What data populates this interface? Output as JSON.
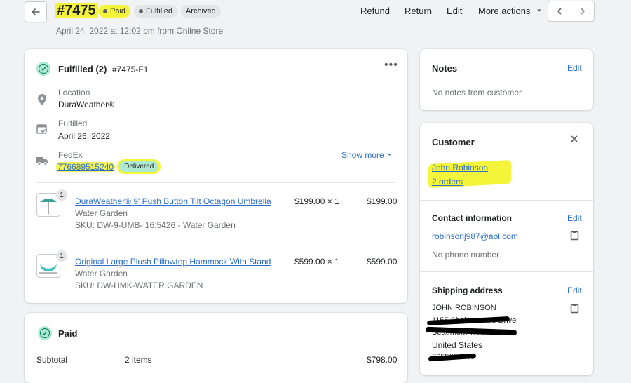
{
  "header": {
    "order_number": "#7475",
    "badges": [
      "Paid",
      "Fulfilled",
      "Archived"
    ],
    "subtitle": "April 24, 2022 at 12:02 pm from Online Store",
    "actions": [
      "Refund",
      "Return",
      "Edit",
      "More actions"
    ]
  },
  "fulfillment": {
    "title": "Fulfilled (2)",
    "fulfillment_id": "#7475-F1",
    "location_label": "Location",
    "location_value": "DuraWeather®",
    "fulfilled_label": "Fulfilled",
    "fulfilled_date": "April 26, 2022",
    "carrier": "FedEx",
    "tracking_number": "776689515240",
    "tracking_status": "Delivered",
    "show_more": "Show more",
    "items": [
      {
        "name": "DuraWeather® 9' Push Button Tilt Octagon Umbrella",
        "vendor": "Water Garden",
        "sku": "SKU: DW-9-UMB- 16:5426 - Water Garden",
        "price_qty": "$199.00 × 1",
        "total": "$199.00",
        "qty_badge": "1"
      },
      {
        "name": "Original Large Plush Pillowtop Hammock With Stand",
        "vendor": "Water Garden",
        "sku": "SKU: DW-HMK-WATER GARDEN",
        "price_qty": "$599.00 × 1",
        "total": "$599.00",
        "qty_badge": "1"
      }
    ]
  },
  "paid": {
    "title": "Paid",
    "subtotal_label": "Subtotal",
    "subtotal_items": "2 items",
    "subtotal_value": "$798.00"
  },
  "notes": {
    "title": "Notes",
    "edit": "Edit",
    "body": "No notes from customer"
  },
  "customer": {
    "title": "Customer",
    "name": "John Robinson",
    "orders": "2 orders",
    "contact_title": "Contact information",
    "contact_edit": "Edit",
    "email": "robinsonj987@aol.com",
    "phone": "No phone number",
    "shipping_title": "Shipping address",
    "shipping_edit": "Edit",
    "shipping_name": "JOHN ROBINSON",
    "shipping_line1": "1155 Shakespeare Drive",
    "shipping_line2": "Beaumont TX 77706",
    "shipping_country": "United States",
    "shipping_phone": "7655603468"
  }
}
